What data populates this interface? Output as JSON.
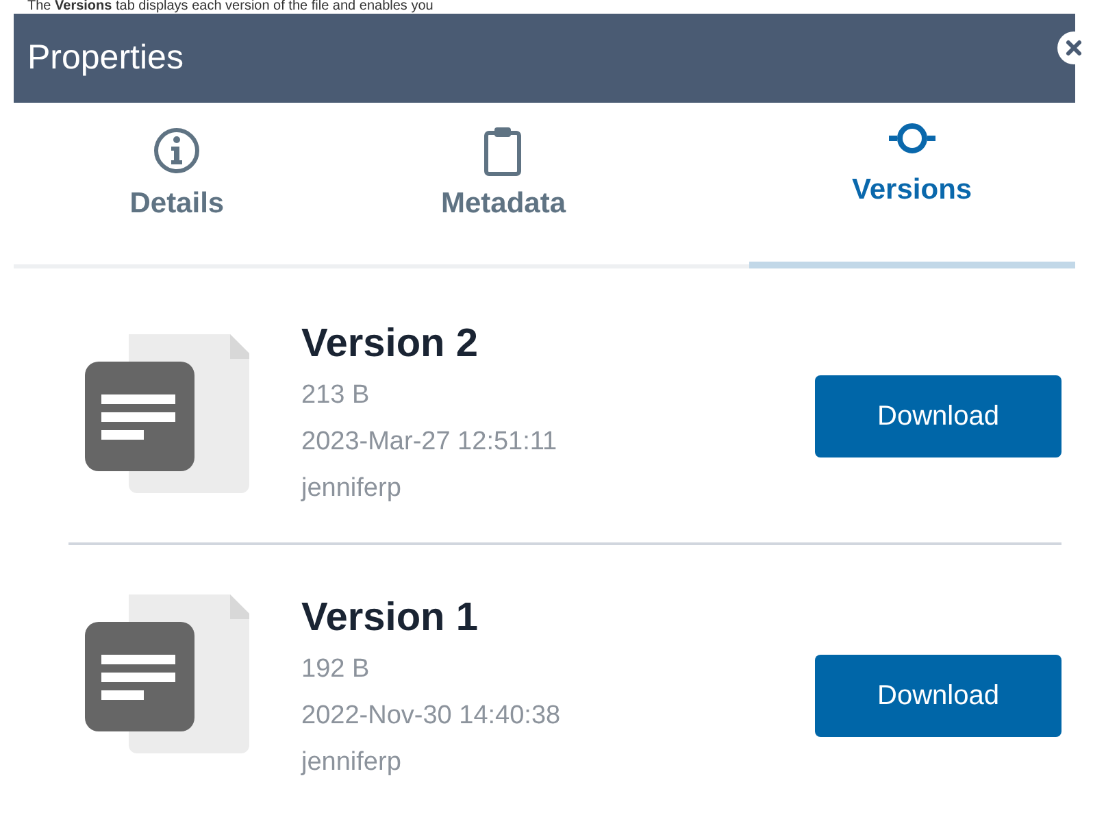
{
  "caption": "The **Versions** tab displays each version of the file and enables you",
  "panel": {
    "title": "Properties"
  },
  "tabs": [
    {
      "label": "Details",
      "kind": "info",
      "selected": false
    },
    {
      "label": "Metadata",
      "kind": "clipboard",
      "selected": false
    },
    {
      "label": "Versions",
      "kind": "versions",
      "selected": true
    }
  ],
  "versions": [
    {
      "name": "Version 2",
      "size": "213 B",
      "date": "2023-Mar-27 12:51:11",
      "user": "jenniferp",
      "button": "Download"
    },
    {
      "name": "Version 1",
      "size": "192 B",
      "date": "2022-Nov-30 14:40:38",
      "user": "jenniferp",
      "button": "Download"
    }
  ]
}
